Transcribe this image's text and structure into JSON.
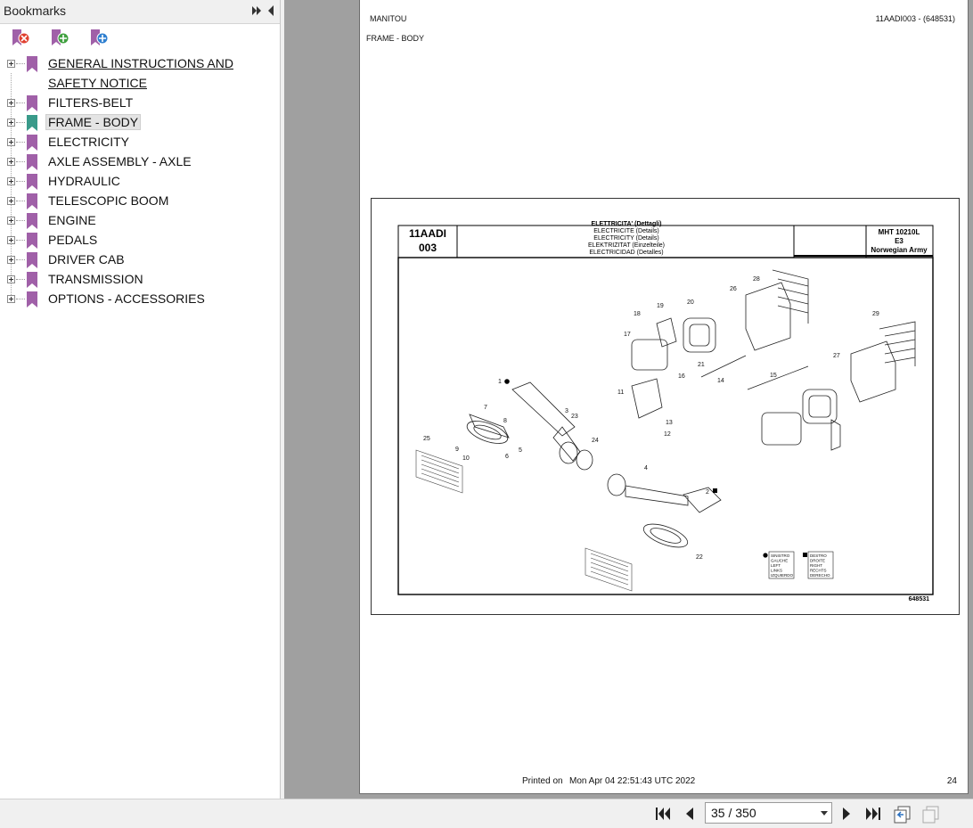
{
  "sidebar": {
    "title": "Bookmarks",
    "toolbar": [
      "delete-bookmark",
      "add-bookmark",
      "add-child-bookmark"
    ],
    "items": [
      {
        "label": "GENERAL INSTRUCTIONS AND",
        "label2": "SAFETY NOTICE"
      },
      {
        "label": "FILTERS-BELT"
      },
      {
        "label": "FRAME - BODY"
      },
      {
        "label": "ELECTRICITY"
      },
      {
        "label": "AXLE ASSEMBLY - AXLE"
      },
      {
        "label": "HYDRAULIC"
      },
      {
        "label": "TELESCOPIC BOOM"
      },
      {
        "label": "ENGINE"
      },
      {
        "label": "PEDALS"
      },
      {
        "label": "DRIVER CAB"
      },
      {
        "label": "TRANSMISSION"
      },
      {
        "label": "OPTIONS - ACCESSORIES"
      }
    ],
    "colors": {
      "bookmark": "#a060a8",
      "bookmark_active": "#3a9a8a"
    }
  },
  "page": {
    "brand": "MANITOU",
    "doc_ref": "11AADI003 - (648531)",
    "section": "FRAME - BODY",
    "printed_label": "Printed on",
    "printed_date": "Mon Apr 04 22:51:43 UTC 2022",
    "page_number": "24",
    "drawing": {
      "code_line1": "11AADI",
      "code_line2": "003",
      "titles": [
        "ELETTRICITA' (Dettagli)",
        "ELECTRICITE (Details)",
        "ELECTRICITY (Details)",
        "ELEKTRIZITAT (Einzelteile)",
        "ELECTRICIDAD (Detalles)"
      ],
      "model": "MHT 10210L",
      "model_sub": "E3",
      "model_owner": "Norwegian Army",
      "drawing_no": "648531",
      "legend_left": [
        "SINISTRO",
        "GAUCHE",
        "LEFT",
        "LINKS",
        "IZQUIERDO"
      ],
      "legend_right": [
        "DESTRO",
        "DROITE",
        "RIGHT",
        "RECHTS",
        "DERECHO"
      ],
      "callouts": [
        "1",
        "2",
        "3",
        "4",
        "5",
        "6",
        "7",
        "8",
        "9",
        "10",
        "11",
        "12",
        "13",
        "14",
        "15",
        "16",
        "17",
        "18",
        "19",
        "20",
        "21",
        "22",
        "23",
        "24",
        "25",
        "26",
        "27",
        "28",
        "29"
      ]
    }
  },
  "nav": {
    "page_display": "35 / 350"
  }
}
